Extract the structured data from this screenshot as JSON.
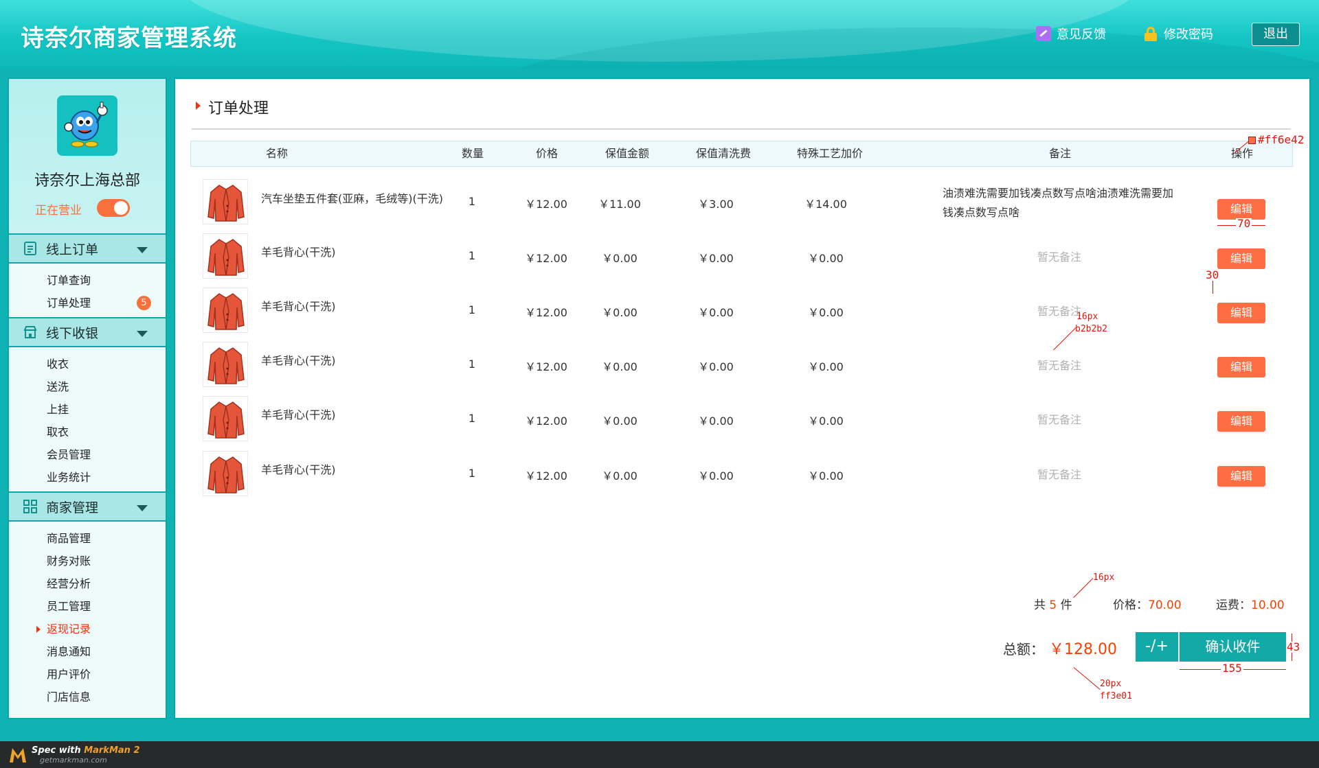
{
  "header": {
    "app_title": "诗奈尔商家管理系统",
    "feedback": "意见反馈",
    "change_password": "修改密码",
    "logout": "退出"
  },
  "profile": {
    "store_name": "诗奈尔上海总部",
    "status_label": "正在营业",
    "status_on": true
  },
  "nav": {
    "groups": [
      {
        "title": "线上订单",
        "icon": "list-icon",
        "items": [
          "订单查询",
          "订单处理"
        ],
        "badge_item": "订单处理",
        "badge": "5"
      },
      {
        "title": "线下收银",
        "icon": "store-icon",
        "items": [
          "收衣",
          "送洗",
          "上挂",
          "取衣",
          "会员管理",
          "业务统计"
        ]
      },
      {
        "title": "商家管理",
        "icon": "grid-icon",
        "items": [
          "商品管理",
          "财务对账",
          "经营分析",
          "员工管理",
          "返现记录",
          "消息通知",
          "用户评价",
          "门店信息"
        ],
        "active": "返现记录"
      }
    ]
  },
  "page": {
    "title": "订单处理"
  },
  "table": {
    "headers": [
      "名称",
      "数量",
      "价格",
      "保值金额",
      "保值清洗费",
      "特殊工艺加价",
      "备注",
      "操作"
    ],
    "rows": [
      {
        "name": "汽车坐垫五件套(亚麻，毛绒等)(干洗)",
        "qty": "1",
        "price": "￥12.00",
        "insured": "￥11.00",
        "wash_fee": "￥3.00",
        "craft": "￥14.00",
        "remark": "油渍难洗需要加钱凑点数写点啥油渍难洗需要加钱凑点数写点啥",
        "action": "编辑"
      },
      {
        "name": "羊毛背心(干洗)",
        "qty": "1",
        "price": "￥12.00",
        "insured": "￥0.00",
        "wash_fee": "￥0.00",
        "craft": "￥0.00",
        "remark": "暂无备注",
        "action": "编辑"
      },
      {
        "name": "羊毛背心(干洗)",
        "qty": "1",
        "price": "￥12.00",
        "insured": "￥0.00",
        "wash_fee": "￥0.00",
        "craft": "￥0.00",
        "remark": "暂无备注",
        "action": "编辑"
      },
      {
        "name": "羊毛背心(干洗)",
        "qty": "1",
        "price": "￥12.00",
        "insured": "￥0.00",
        "wash_fee": "￥0.00",
        "craft": "￥0.00",
        "remark": "暂无备注",
        "action": "编辑"
      },
      {
        "name": "羊毛背心(干洗)",
        "qty": "1",
        "price": "￥12.00",
        "insured": "￥0.00",
        "wash_fee": "￥0.00",
        "craft": "￥0.00",
        "remark": "暂无备注",
        "action": "编辑"
      },
      {
        "name": "羊毛背心(干洗)",
        "qty": "1",
        "price": "￥12.00",
        "insured": "￥0.00",
        "wash_fee": "￥0.00",
        "craft": "￥0.00",
        "remark": "暂无备注",
        "action": "编辑"
      }
    ]
  },
  "summary": {
    "count_prefix": "共",
    "count": "5",
    "count_suffix": "件",
    "price_label": "价格：",
    "price": "70.00",
    "shipping_label": "运费：",
    "shipping": "10.00",
    "total_label": "总额：",
    "total": "￥128.00",
    "adjust_button": "-/+",
    "confirm_button": "确认收件"
  },
  "annotations": {
    "edit_color": "#ff6e42",
    "edit_width": "70",
    "edit_height": "30",
    "remark_size": "16px",
    "remark_color": "b2b2b2",
    "count_size": "16px",
    "confirm_height": "43",
    "confirm_width": "155",
    "total_size": "20px",
    "total_color": "ff3e01"
  },
  "footer": {
    "spec_prefix": "Spec with ",
    "spec_brand": "MarkMan 2",
    "site": "getmarkman.com"
  },
  "colors": {
    "brand": "#14c0c0",
    "accent": "#ff6e42",
    "total": "#ff3e01",
    "muted": "#b2b2b2"
  }
}
